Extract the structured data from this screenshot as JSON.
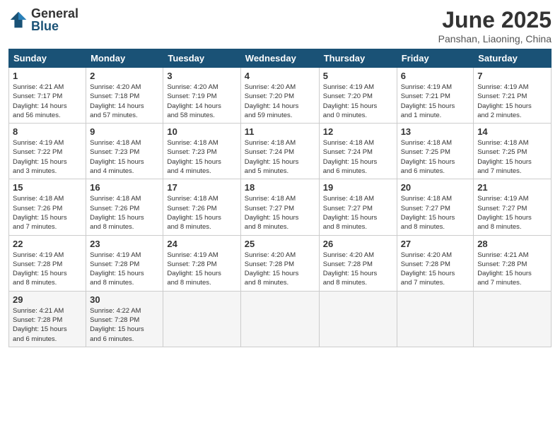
{
  "header": {
    "logo_general": "General",
    "logo_blue": "Blue",
    "month_title": "June 2025",
    "subtitle": "Panshan, Liaoning, China"
  },
  "days_of_week": [
    "Sunday",
    "Monday",
    "Tuesday",
    "Wednesday",
    "Thursday",
    "Friday",
    "Saturday"
  ],
  "weeks": [
    [
      {
        "day": "1",
        "info": "Sunrise: 4:21 AM\nSunset: 7:17 PM\nDaylight: 14 hours\nand 56 minutes."
      },
      {
        "day": "2",
        "info": "Sunrise: 4:20 AM\nSunset: 7:18 PM\nDaylight: 14 hours\nand 57 minutes."
      },
      {
        "day": "3",
        "info": "Sunrise: 4:20 AM\nSunset: 7:19 PM\nDaylight: 14 hours\nand 58 minutes."
      },
      {
        "day": "4",
        "info": "Sunrise: 4:20 AM\nSunset: 7:20 PM\nDaylight: 14 hours\nand 59 minutes."
      },
      {
        "day": "5",
        "info": "Sunrise: 4:19 AM\nSunset: 7:20 PM\nDaylight: 15 hours\nand 0 minutes."
      },
      {
        "day": "6",
        "info": "Sunrise: 4:19 AM\nSunset: 7:21 PM\nDaylight: 15 hours\nand 1 minute."
      },
      {
        "day": "7",
        "info": "Sunrise: 4:19 AM\nSunset: 7:21 PM\nDaylight: 15 hours\nand 2 minutes."
      }
    ],
    [
      {
        "day": "8",
        "info": "Sunrise: 4:19 AM\nSunset: 7:22 PM\nDaylight: 15 hours\nand 3 minutes."
      },
      {
        "day": "9",
        "info": "Sunrise: 4:18 AM\nSunset: 7:23 PM\nDaylight: 15 hours\nand 4 minutes."
      },
      {
        "day": "10",
        "info": "Sunrise: 4:18 AM\nSunset: 7:23 PM\nDaylight: 15 hours\nand 4 minutes."
      },
      {
        "day": "11",
        "info": "Sunrise: 4:18 AM\nSunset: 7:24 PM\nDaylight: 15 hours\nand 5 minutes."
      },
      {
        "day": "12",
        "info": "Sunrise: 4:18 AM\nSunset: 7:24 PM\nDaylight: 15 hours\nand 6 minutes."
      },
      {
        "day": "13",
        "info": "Sunrise: 4:18 AM\nSunset: 7:25 PM\nDaylight: 15 hours\nand 6 minutes."
      },
      {
        "day": "14",
        "info": "Sunrise: 4:18 AM\nSunset: 7:25 PM\nDaylight: 15 hours\nand 7 minutes."
      }
    ],
    [
      {
        "day": "15",
        "info": "Sunrise: 4:18 AM\nSunset: 7:26 PM\nDaylight: 15 hours\nand 7 minutes."
      },
      {
        "day": "16",
        "info": "Sunrise: 4:18 AM\nSunset: 7:26 PM\nDaylight: 15 hours\nand 8 minutes."
      },
      {
        "day": "17",
        "info": "Sunrise: 4:18 AM\nSunset: 7:26 PM\nDaylight: 15 hours\nand 8 minutes."
      },
      {
        "day": "18",
        "info": "Sunrise: 4:18 AM\nSunset: 7:27 PM\nDaylight: 15 hours\nand 8 minutes."
      },
      {
        "day": "19",
        "info": "Sunrise: 4:18 AM\nSunset: 7:27 PM\nDaylight: 15 hours\nand 8 minutes."
      },
      {
        "day": "20",
        "info": "Sunrise: 4:18 AM\nSunset: 7:27 PM\nDaylight: 15 hours\nand 8 minutes."
      },
      {
        "day": "21",
        "info": "Sunrise: 4:19 AM\nSunset: 7:27 PM\nDaylight: 15 hours\nand 8 minutes."
      }
    ],
    [
      {
        "day": "22",
        "info": "Sunrise: 4:19 AM\nSunset: 7:28 PM\nDaylight: 15 hours\nand 8 minutes."
      },
      {
        "day": "23",
        "info": "Sunrise: 4:19 AM\nSunset: 7:28 PM\nDaylight: 15 hours\nand 8 minutes."
      },
      {
        "day": "24",
        "info": "Sunrise: 4:19 AM\nSunset: 7:28 PM\nDaylight: 15 hours\nand 8 minutes."
      },
      {
        "day": "25",
        "info": "Sunrise: 4:20 AM\nSunset: 7:28 PM\nDaylight: 15 hours\nand 8 minutes."
      },
      {
        "day": "26",
        "info": "Sunrise: 4:20 AM\nSunset: 7:28 PM\nDaylight: 15 hours\nand 8 minutes."
      },
      {
        "day": "27",
        "info": "Sunrise: 4:20 AM\nSunset: 7:28 PM\nDaylight: 15 hours\nand 7 minutes."
      },
      {
        "day": "28",
        "info": "Sunrise: 4:21 AM\nSunset: 7:28 PM\nDaylight: 15 hours\nand 7 minutes."
      }
    ],
    [
      {
        "day": "29",
        "info": "Sunrise: 4:21 AM\nSunset: 7:28 PM\nDaylight: 15 hours\nand 6 minutes."
      },
      {
        "day": "30",
        "info": "Sunrise: 4:22 AM\nSunset: 7:28 PM\nDaylight: 15 hours\nand 6 minutes."
      },
      {
        "day": "",
        "info": ""
      },
      {
        "day": "",
        "info": ""
      },
      {
        "day": "",
        "info": ""
      },
      {
        "day": "",
        "info": ""
      },
      {
        "day": "",
        "info": ""
      }
    ]
  ]
}
